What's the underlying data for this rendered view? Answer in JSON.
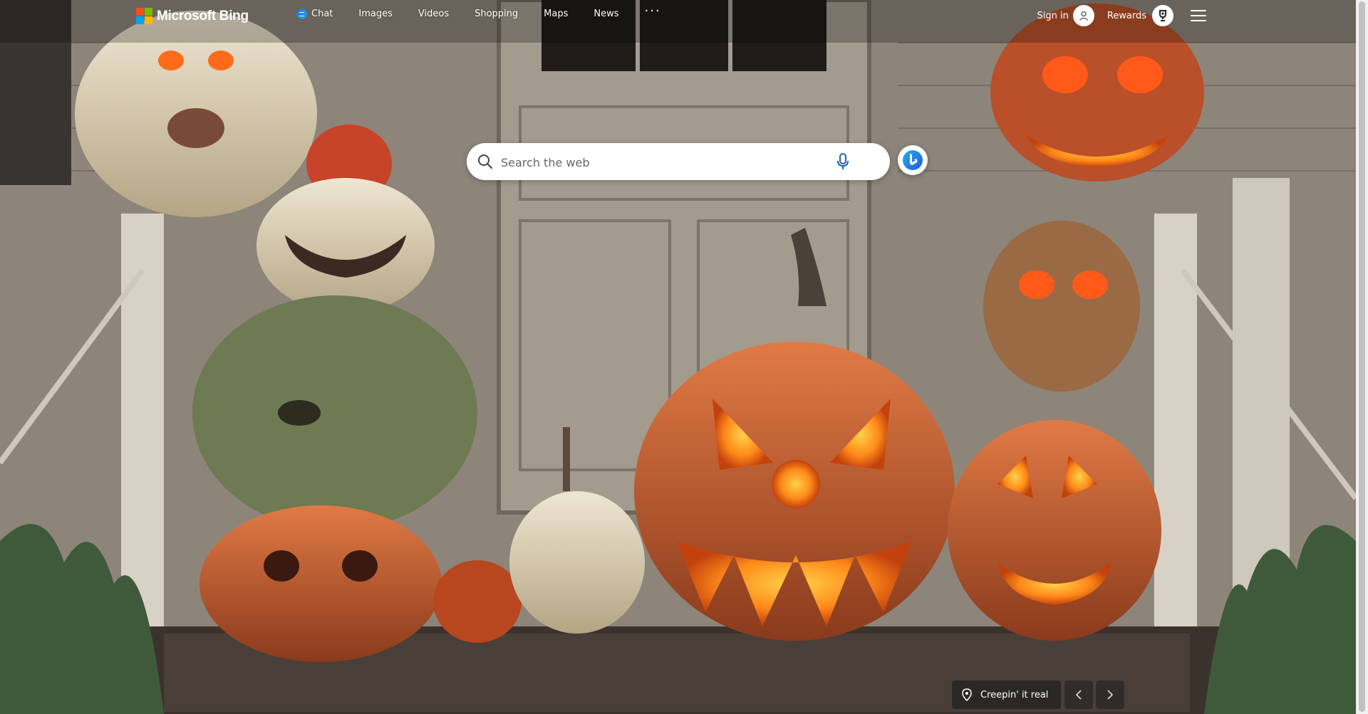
{
  "brand": {
    "name": "Microsoft Bing",
    "logo_colors": [
      "#f25022",
      "#7fba00",
      "#00a4ef",
      "#ffb900"
    ]
  },
  "nav": {
    "items": [
      {
        "label": "Chat",
        "icon": "chat-icon"
      },
      {
        "label": "Images"
      },
      {
        "label": "Videos"
      },
      {
        "label": "Shopping"
      },
      {
        "label": "Maps"
      },
      {
        "label": "News"
      }
    ],
    "more_label": "···"
  },
  "account": {
    "signin_label": "Sign in",
    "avatar_icon": "user-icon",
    "rewards_label": "Rewards",
    "rewards_icon": "trophy-icon",
    "menu_icon": "hamburger-icon"
  },
  "search": {
    "placeholder": "Search the web",
    "value": "",
    "search_icon": "search-icon",
    "mic_icon": "microphone-icon",
    "copilot_icon": "bing-copilot-icon"
  },
  "background": {
    "caption": "Creepin' it real",
    "location_icon": "location-pin-icon",
    "prev_icon": "chevron-left-icon",
    "next_icon": "chevron-right-icon"
  }
}
